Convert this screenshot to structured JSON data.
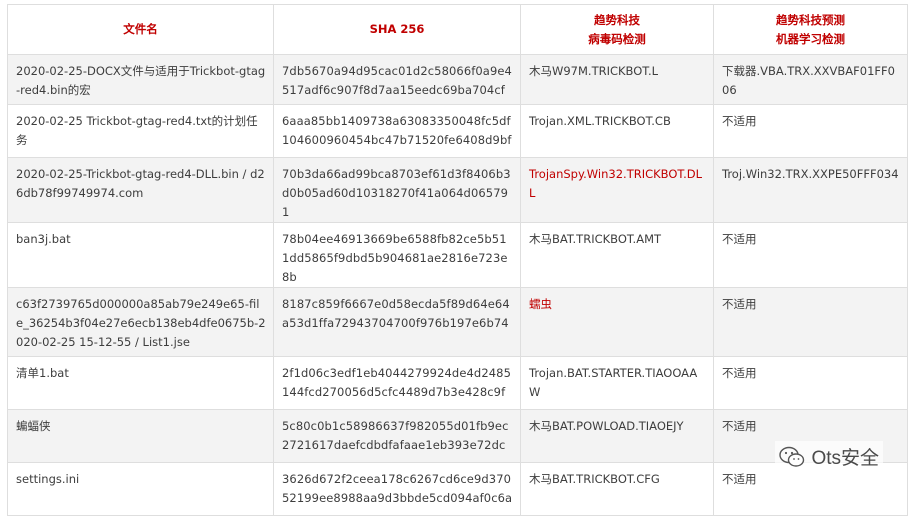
{
  "table": {
    "headers": [
      "文件名",
      [
        "SHA 256"
      ],
      [
        "趋势科技",
        "病毒码检测"
      ],
      [
        "趋势科技预测",
        "机器学习检测"
      ]
    ],
    "header_filename": "文件名",
    "header_sha": "SHA 256",
    "header_pattern_l1": "趋势科技",
    "header_pattern_l2": "病毒码检测",
    "header_ml_l1": "趋势科技预测",
    "header_ml_l2": "机器学习检测",
    "rows": [
      {
        "filename": "2020-02-25-DOCX文件与适用于Trickbot-gtag-red4.bin的宏",
        "sha256": "7db5670a94d95cac01d2c58066f0a9e4517adf6c907f8d7aa15eedc69ba704cf",
        "pattern": "木马W97M.TRICKBOT.L",
        "ml": "下载器.VBA.TRX.XXVBAF01FF006"
      },
      {
        "filename": "2020-02-25 Trickbot-gtag-red4.txt的计划任务",
        "sha256": "6aaa85bb1409738a63083350048fc5df104600960454bc47b71520fe6408d9bf",
        "pattern": "Trojan.XML.TRICKBOT.CB",
        "ml": "不适用"
      },
      {
        "filename": "2020-02-25-Trickbot-gtag-red4-DLL.bin / d26db78f99749974.com",
        "sha256": "70b3da66ad99bca8703ef61d3f8406b3d0b05ad60d10318270f41a064d065791",
        "pattern": "TrojanSpy.Win32.TRICKBOT.DLL",
        "ml": "Troj.Win32.TRX.XXPE50FFF034"
      },
      {
        "filename": "ban3j.bat",
        "sha256": "78b04ee46913669be6588fb82ce5b511dd5865f9dbd5b904681ae2816e723e8b",
        "pattern": "木马BAT.TRICKBOT.AMT",
        "ml": "不适用"
      },
      {
        "filename": "c63f2739765d000000a85ab79e249e65-file_36254b3f04e27e6ecb138eb4dfe0675b-2020-02-25 15-12-55 / List1.jse",
        "sha256": "8187c859f6667e0d58ecda5f89d64e64a53d1ffa72943704700f976b197e6b74",
        "pattern": "蠕虫",
        "ml": "不适用"
      },
      {
        "filename": "清单1.bat",
        "sha256": "2f1d06c3edf1eb4044279924de4d2485144fcd270056d5cfc4489d7b3e428c9f",
        "pattern": "Trojan.BAT.STARTER.TIAOOAAW",
        "ml": "不适用"
      },
      {
        "filename": "蝙蝠侠",
        "sha256": "5c80c0b1c58986637f982055d01fb9ec2721617daefcdbdfafaae1eb393e72dc",
        "pattern": "木马BAT.POWLOAD.TIAOEJY",
        "ml": "不适用"
      },
      {
        "filename": "settings.ini",
        "sha256": "3626d672f2ceea178c6267cd6ce9d37052199ee8988aa9d3bbde5cd094af0c6a",
        "pattern": "木马BAT.TRICKBOT.CFG",
        "ml": "不适用"
      }
    ]
  },
  "watermark": {
    "text": "Ots安全",
    "icon": "wechat-icon"
  },
  "colors": {
    "header_text": "#c00000",
    "highlight_text": "#c00000",
    "row_shade": "#f3f3f3",
    "border": "#dedede"
  }
}
